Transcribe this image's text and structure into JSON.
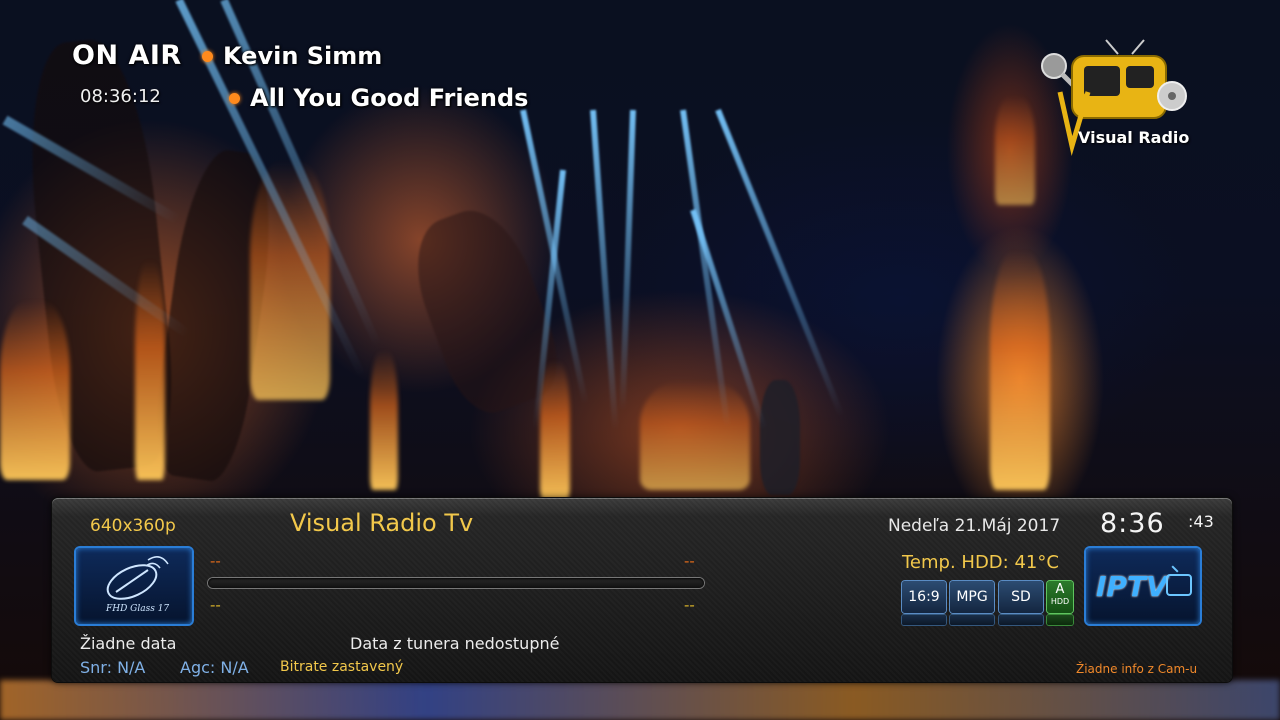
{
  "overlay": {
    "on_air": "ON AIR",
    "time": "08:36:12",
    "artist": "Kevin Simm",
    "song": "All You Good Friends",
    "logo_text": "Visual Radio",
    "logo_initial": "V"
  },
  "infobar": {
    "resolution": "640x360p",
    "channel_name": "Visual Radio Tv",
    "date": "Nedeľa  21.Máj 2017",
    "clock": "8:36",
    "clock_seconds": ":43",
    "picon_text": "FHD Glass 17",
    "event_now_time": "--",
    "event_now_dur": "--",
    "event_next_time": "--",
    "event_next_dur": "--",
    "progress": 0,
    "temp": "Temp. HDD: 41°C",
    "badges": {
      "aspect": "16:9",
      "codec": "MPG",
      "definition": "SD",
      "audio": "A",
      "audio_sub": "HDD"
    },
    "iptv_label": "IPTV",
    "no_data": "Žiadne data",
    "tuner_msg": "Data z tunera nedostupné",
    "snr": "Snr: N/A",
    "agc": "Agc: N/A",
    "bitrate": "Bitrate zastavený",
    "cam_info": "Žiadne info z Cam-u"
  },
  "colors": {
    "accent_yellow": "#f2c84b",
    "accent_orange": "#f0882a",
    "accent_blue": "#2a7dd6",
    "label_blue": "#7fb0e6"
  }
}
